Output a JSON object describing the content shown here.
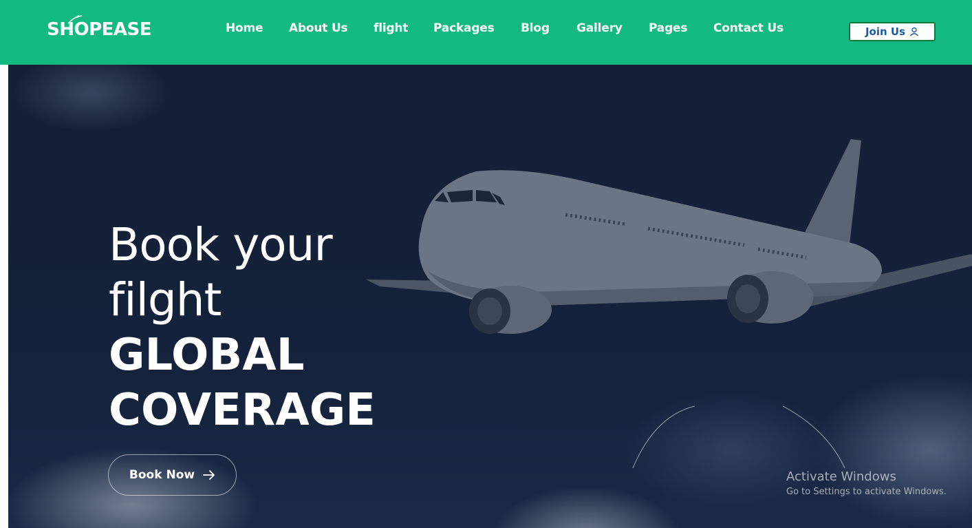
{
  "brand": {
    "logo_text": "SHOPEASE"
  },
  "nav": {
    "items": [
      "Home",
      "About Us",
      "flight",
      "Packages",
      "Blog",
      "Gallery",
      "Pages",
      "Contact Us"
    ]
  },
  "header": {
    "join_label": "Join Us"
  },
  "hero": {
    "line1": "Book your",
    "line2": "filght",
    "line3": "GLOBAL",
    "line4": "COVERAGE",
    "cta_label": "Book Now"
  },
  "overlay": {
    "activate_title": "Activate Windows",
    "activate_sub": "Go to Settings to activate Windows."
  },
  "colors": {
    "header_bg": "#12b981",
    "hero_bg": "#142035",
    "join_text": "#1a5aa8"
  },
  "icons": [
    "plane-logo-icon",
    "user-icon",
    "arrow-right-icon"
  ]
}
